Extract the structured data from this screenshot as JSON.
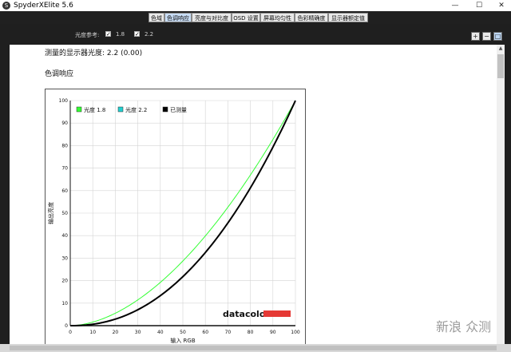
{
  "window": {
    "title": "SpyderXElite 5.6",
    "app_icon_glyph": "S",
    "minimize_glyph": "—",
    "maximize_glyph": "☐",
    "close_glyph": "✕"
  },
  "tabs": [
    {
      "label": "色域",
      "active": false
    },
    {
      "label": "色调响应",
      "active": true
    },
    {
      "label": "亮度与对比度",
      "active": false
    },
    {
      "label": "OSD 设置",
      "active": false
    },
    {
      "label": "屏幕均匀性",
      "active": false
    },
    {
      "label": "色彩精确度",
      "active": false
    },
    {
      "label": "显示器额定值",
      "active": false
    }
  ],
  "options": {
    "gamma_ref_label": "光度参考:",
    "gamma_18_label": "1.8",
    "gamma_18_checked": true,
    "gamma_22_label": "2.2",
    "gamma_22_checked": true,
    "check_glyph": "✓"
  },
  "zoom": {
    "zoom_in_glyph": "+",
    "zoom_out_glyph": "−",
    "fit_glyph": "□"
  },
  "content": {
    "measured_gamma": "测量的显示器光度: 2.2 (0.00)",
    "section_title": "色调响应"
  },
  "chart_data": {
    "type": "line",
    "xlabel": "输入 RGB",
    "ylabel": "输出亮度",
    "xlim": [
      0,
      100
    ],
    "ylim": [
      0,
      100
    ],
    "ticks": [
      "0",
      "10",
      "20",
      "30",
      "40",
      "50",
      "60",
      "70",
      "80",
      "90",
      "100"
    ],
    "grid": true,
    "legend_position": "top-left",
    "series": [
      {
        "name": "光度 1.8",
        "color": "#33ff33",
        "gamma": 1.8
      },
      {
        "name": "光度 2.2",
        "color": "#22d0d0",
        "gamma": 2.2
      },
      {
        "name": "已测量",
        "color": "#000000",
        "gamma": 2.2
      }
    ],
    "brand": "datacolor",
    "brand_color": "#e53935"
  },
  "watermark": "新浪 众测"
}
